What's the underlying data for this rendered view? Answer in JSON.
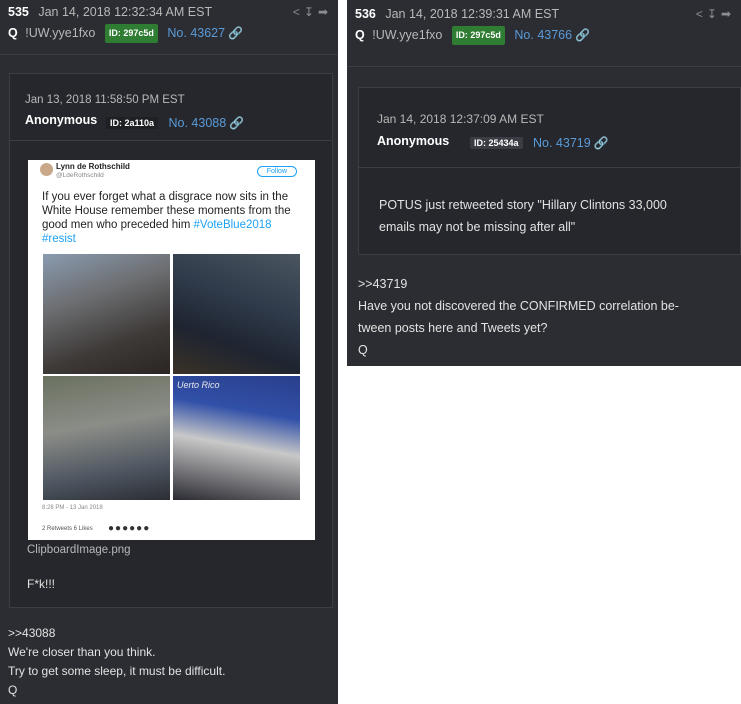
{
  "left_post": {
    "number": "535",
    "date": "Jan 14, 2018 12:32:34 AM EST",
    "trip_name": "Q",
    "tripcode": "!UW.yye1fxo",
    "id_badge": "ID: 297c5d",
    "post_link": "No. 43627",
    "quoted": {
      "date": "Jan 13, 2018 11:58:50 PM EST",
      "name": "Anonymous",
      "id_badge": "ID: 2a110a",
      "post_link": "No. 43088",
      "image": {
        "author_name": "Lynn de Rothschild",
        "author_handle": "@LdeRothschild",
        "follow_label": "Follow",
        "text": "If you ever forget what a disgrace now sits in the White House remember these moments from the good men who preceded him",
        "hashtags": "#VoteBlue2018 #resist",
        "sign_text": "Uerto Rico",
        "timestamp": "8:28 PM - 13 Jan 2018",
        "stats": "2 Retweets  6 Likes"
      },
      "filename": "ClipboardImage.png",
      "body": "F*k!!!"
    },
    "body_lines": [
      ">>43088",
      "We're closer than you think.",
      "Try to get some sleep, it must be difficult.",
      "Q"
    ]
  },
  "right_post": {
    "number": "536",
    "date": "Jan 14, 2018 12:39:31 AM EST",
    "trip_name": "Q",
    "tripcode": "!UW.yye1fxo",
    "id_badge": "ID: 297c5d",
    "post_link": "No. 43766",
    "quoted": {
      "date": "Jan 14, 2018 12:37:09 AM EST",
      "name": "Anonymous",
      "id_badge": "ID: 25434a",
      "post_link": "No. 43719",
      "body_lines": [
        "POTUS just retweeted story \"Hillary Clintons 33,000",
        "emails may not be missing after all\""
      ]
    },
    "body_lines": [
      ">>43719",
      "Have you not discovered the CONFIRMED correlation be-",
      "tween posts here and Tweets yet?",
      "Q"
    ]
  },
  "icons": [
    "share-icon",
    "download-icon",
    "forward-icon",
    "chain-link-icon"
  ],
  "colors": {
    "panel": "#2b2d33",
    "inner": "#25272c",
    "link": "#5a9bd8",
    "id_green": "#2e7d32",
    "hashtag": "#1da1f2"
  }
}
